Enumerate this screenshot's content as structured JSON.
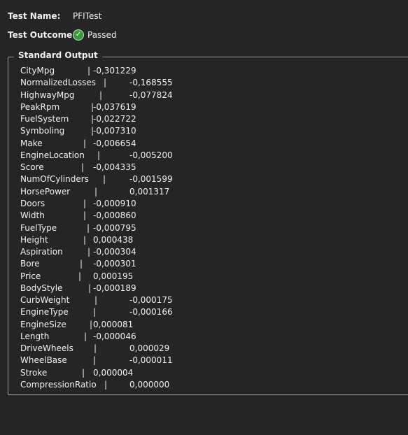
{
  "test_name_label": "Test Name:",
  "test_name": "PFITest",
  "test_outcome_label": "Test Outcome:",
  "test_outcome": "Passed",
  "status_icon": "check-circle-icon",
  "output_title": "Standard Output",
  "rows": [
    {
      "name": "CityMpg",
      "value": "-0,301229"
    },
    {
      "name": "NormalizedLosses",
      "value": "-0,168555"
    },
    {
      "name": "HighwayMpg",
      "value": "-0,077824"
    },
    {
      "name": "PeakRpm",
      "value": "-0,037619"
    },
    {
      "name": "FuelSystem",
      "value": "-0,022722"
    },
    {
      "name": "Symboling",
      "value": "-0,007310"
    },
    {
      "name": "Make",
      "value": "-0,006654"
    },
    {
      "name": "EngineLocation",
      "value": "-0,005200"
    },
    {
      "name": "Score",
      "value": "-0,004335"
    },
    {
      "name": "NumOfCylinders",
      "value": "-0,001599"
    },
    {
      "name": "HorsePower",
      "value": "0,001317"
    },
    {
      "name": "Doors",
      "value": "-0,000910"
    },
    {
      "name": "Width",
      "value": "-0,000860"
    },
    {
      "name": "FuelType",
      "value": "-0,000795"
    },
    {
      "name": "Height",
      "value": "0,000438"
    },
    {
      "name": "Aspiration",
      "value": "-0,000304"
    },
    {
      "name": "Bore",
      "value": "-0,000301"
    },
    {
      "name": "Price",
      "value": "0,000195"
    },
    {
      "name": "BodyStyle",
      "value": "-0,000189"
    },
    {
      "name": "CurbWeight",
      "value": "-0,000175"
    },
    {
      "name": "EngineType",
      "value": "-0,000166"
    },
    {
      "name": "EngineSize",
      "value": "0,000081"
    },
    {
      "name": "Length",
      "value": "-0,000046"
    },
    {
      "name": "DriveWheels",
      "value": "0,000029"
    },
    {
      "name": "WheelBase",
      "value": "-0,000011"
    },
    {
      "name": "Stroke",
      "value": "0,000004"
    },
    {
      "name": "CompressionRatio",
      "value": "0,000000"
    }
  ]
}
